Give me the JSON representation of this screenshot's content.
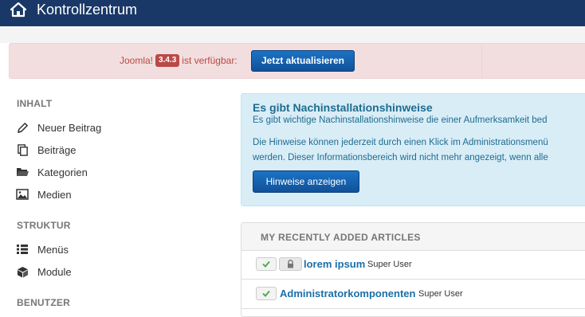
{
  "header": {
    "title": "Kontrollzentrum"
  },
  "update_alert": {
    "prefix": "Joomla!",
    "version": "3.4.3",
    "suffix": "ist verfügbar:",
    "button": "Jetzt aktualisieren"
  },
  "sidebar": {
    "sections": [
      {
        "title": "INHALT",
        "items": [
          {
            "label": "Neuer Beitrag",
            "icon": "pencil-icon"
          },
          {
            "label": "Beiträge",
            "icon": "copy-icon"
          },
          {
            "label": "Kategorien",
            "icon": "folder-icon"
          },
          {
            "label": "Medien",
            "icon": "image-icon"
          }
        ]
      },
      {
        "title": "STRUKTUR",
        "items": [
          {
            "label": "Menüs",
            "icon": "list-icon"
          },
          {
            "label": "Module",
            "icon": "cube-icon"
          }
        ]
      },
      {
        "title": "BENUTZER",
        "items": []
      }
    ]
  },
  "postinstall": {
    "heading": "Es gibt Nachinstallationshinweise",
    "line1": "Es gibt wichtige Nachinstallationshinweise die einer Aufmerksamkeit bed",
    "line2": "Die Hinweise können jederzeit durch einen Klick im Administrationsmenü",
    "line3": "werden. Dieser Informationsbereich wird nicht mehr angezeigt, wenn alle",
    "button": "Hinweise anzeigen"
  },
  "recent_articles": {
    "title": "MY RECENTLY ADDED ARTICLES",
    "rows": [
      {
        "title": "lorem ipsum",
        "author": "Super User",
        "locked": true
      },
      {
        "title": "Administratorkomponenten",
        "author": "Super User",
        "locked": false
      }
    ]
  },
  "colors": {
    "topbar": "#1a3867",
    "primary_button": "#1b5fa8",
    "link": "#1b6fa8",
    "alert_text": "#b94a48"
  }
}
